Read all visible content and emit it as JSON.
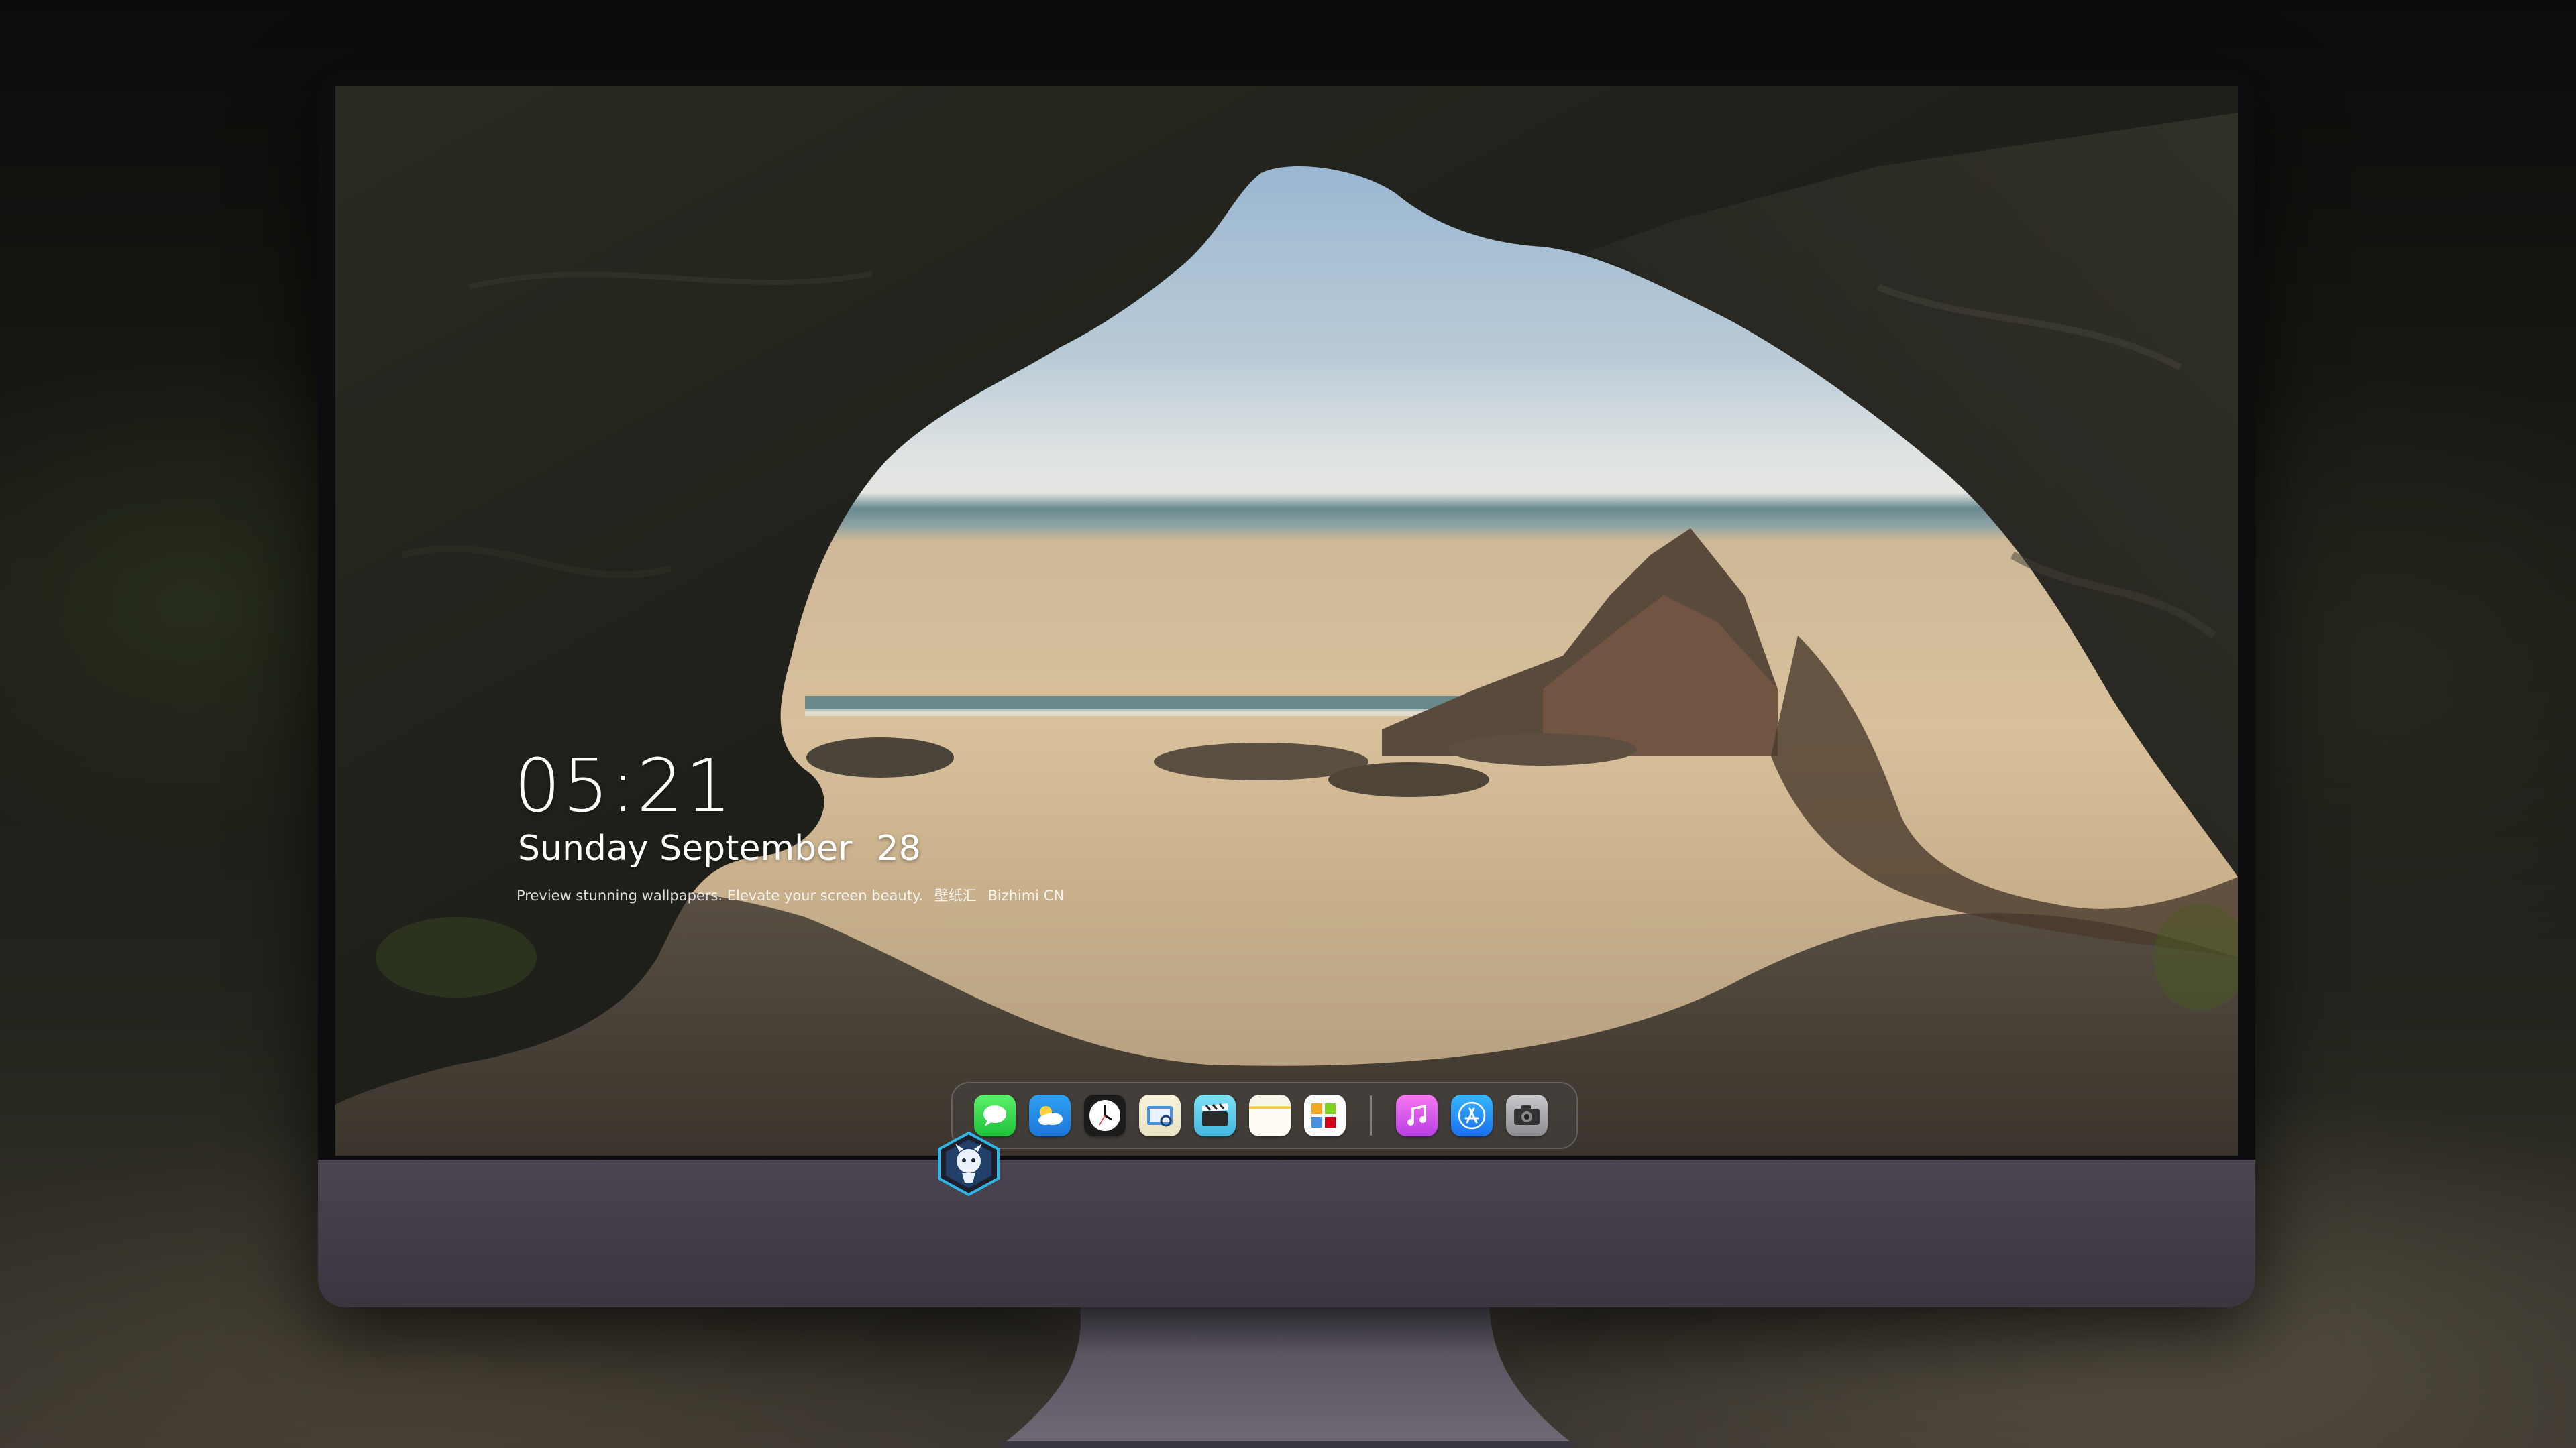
{
  "lock_screen": {
    "time": "05:21",
    "weekday_month": "Sunday September",
    "day": "28",
    "caption_left": "Preview stunning wallpapers. Elevate your screen beauty.",
    "caption_cn": "壁纸汇",
    "caption_right": "Bizhimi CN"
  },
  "dock": {
    "apps": [
      {
        "name": "Messages",
        "icon": "messages-icon",
        "color": "#2fd14a"
      },
      {
        "name": "Weather",
        "icon": "weather-icon",
        "color": "#2a8ff0"
      },
      {
        "name": "Clock",
        "icon": "clock-icon",
        "color": "#1b1b1b"
      },
      {
        "name": "Finder",
        "icon": "finder-icon",
        "color": "#f1ecd0"
      },
      {
        "name": "Clips",
        "icon": "clips-icon",
        "color": "#4fc3e8"
      },
      {
        "name": "Notes",
        "icon": "notes-icon",
        "color": "#f5c93b"
      },
      {
        "name": "Calendar",
        "icon": "calendar-icon",
        "color": "#ffffff"
      },
      {
        "name": "iTunes",
        "icon": "music-icon",
        "color": "#d85aec"
      },
      {
        "name": "App Store",
        "icon": "app-store-icon",
        "color": "#2a8ff0"
      },
      {
        "name": "Camera",
        "icon": "camera-icon",
        "color": "#a5a5a9"
      }
    ]
  },
  "colors": {
    "bezel": "#0d0d10",
    "chin": "#423c47",
    "stand": "#5a5560"
  }
}
